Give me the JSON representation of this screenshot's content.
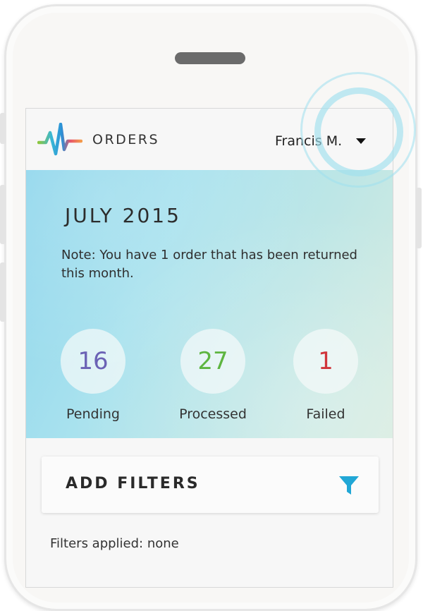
{
  "header": {
    "app_title": "ORDERS",
    "user_name": "Francis M."
  },
  "summary": {
    "month": "JULY 2015",
    "note": "Note: You have 1 order that has been returned this month.",
    "stats": [
      {
        "value": "16",
        "label": "Pending",
        "color": "#6b62b5"
      },
      {
        "value": "27",
        "label": "Processed",
        "color": "#5db540"
      },
      {
        "value": "1",
        "label": "Failed",
        "color": "#d0353b"
      }
    ]
  },
  "filters": {
    "title": "ADD FILTERS",
    "applied_text": "Filters applied: none",
    "icon_color": "#21a7d6"
  },
  "colors": {
    "hero_start": "#8fd6ec",
    "hero_end": "#d6ebdf",
    "ripple": "#9fe0ee"
  }
}
